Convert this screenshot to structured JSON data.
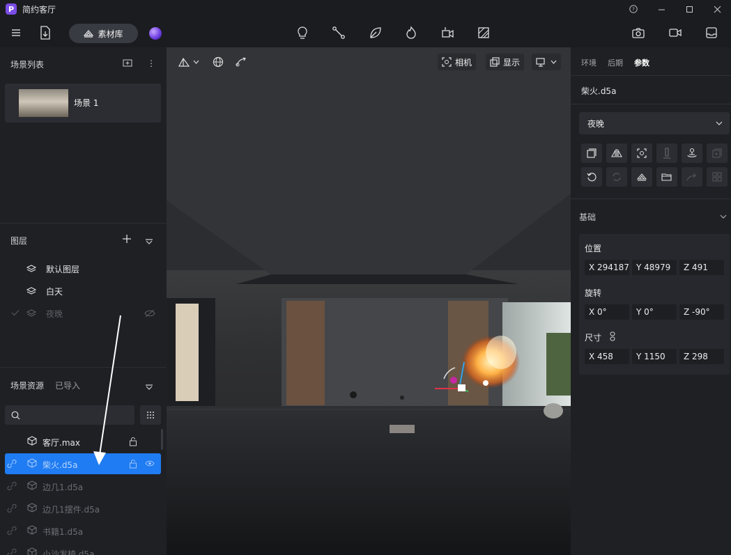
{
  "app": {
    "title": "简约客厅",
    "logo_letter": "P"
  },
  "window_controls": [
    "help-icon",
    "minimize-icon",
    "maximize-icon",
    "close-icon"
  ],
  "toolbar": {
    "library_label": "素材库",
    "center_icons": [
      "bulb-icon",
      "path-icon",
      "leaf-icon",
      "fire-icon",
      "clip-icon",
      "section-icon"
    ],
    "right_icons": [
      "camera-icon",
      "video-icon",
      "inbox-icon"
    ]
  },
  "left": {
    "scene_list_title": "场景列表",
    "scenes": [
      {
        "label": "场景 1"
      }
    ],
    "layers_title": "图层",
    "layers": [
      {
        "label": "默认图层",
        "state": "normal"
      },
      {
        "label": "白天",
        "state": "normal"
      },
      {
        "label": "夜晚",
        "state": "hidden"
      }
    ],
    "assets_tabs": [
      "场景资源",
      "已导入"
    ],
    "search_placeholder": "",
    "assets": [
      {
        "label": "客厅.max",
        "state": "normal"
      },
      {
        "label": "柴火.d5a",
        "state": "selected"
      },
      {
        "label": "边几1.d5a",
        "state": "dim"
      },
      {
        "label": "边几1摆件.d5a",
        "state": "dim"
      },
      {
        "label": "书籍1.d5a",
        "state": "dim"
      },
      {
        "label": "小沙发椅.d5a",
        "state": "dim"
      }
    ]
  },
  "viewport": {
    "camera_label": "相机",
    "display_label": "显示"
  },
  "right": {
    "tabs": [
      "环境",
      "后期",
      "参数"
    ],
    "active_tab": "参数",
    "object_name": "柴火.d5a",
    "variant": "夜晚",
    "section_basic": "基础",
    "position_label": "位置",
    "position": {
      "x": "X 294187",
      "y": "Y 48979",
      "z": "Z 491"
    },
    "rotation_label": "旋转",
    "rotation": {
      "x": "X 0°",
      "y": "Y 0°",
      "z": "Z -90°"
    },
    "size_label": "尺寸",
    "size": {
      "x": "X 458",
      "y": "Y 1150",
      "z": "Z 298"
    }
  },
  "colors": {
    "accent": "#1f7cf2",
    "panel": "#1f2024",
    "field": "#2c2d32"
  }
}
